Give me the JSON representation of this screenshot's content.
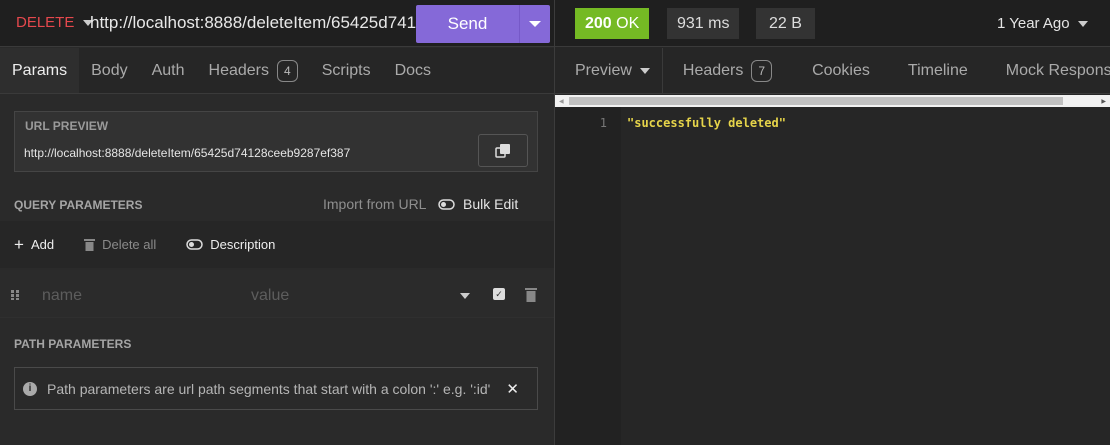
{
  "request": {
    "method": "DELETE",
    "url": "http://localhost:8888/deleteItem/65425d74128",
    "send_label": "Send",
    "tabs": [
      {
        "label": "Params"
      },
      {
        "label": "Body"
      },
      {
        "label": "Auth"
      },
      {
        "label": "Headers",
        "count": "4"
      },
      {
        "label": "Scripts"
      },
      {
        "label": "Docs"
      }
    ],
    "url_preview": {
      "title": "URL PREVIEW",
      "value": "http://localhost:8888/deleteItem/65425d74128ceeb9287ef387"
    },
    "query": {
      "title": "QUERY PARAMETERS",
      "import_label": "Import from URL",
      "bulk_edit_label": "Bulk Edit",
      "add_label": "Add",
      "delete_all_label": "Delete all",
      "description_label": "Description",
      "name_placeholder": "name",
      "value_placeholder": "value"
    },
    "path": {
      "title": "PATH PARAMETERS",
      "info": "Path parameters are url path segments that start with a colon ':' e.g. ':id'"
    }
  },
  "response": {
    "status": "200",
    "status_text": "OK",
    "status_color": "#75ba24",
    "time": "931 ms",
    "size": "22 B",
    "history": "1 Year Ago",
    "tabs": [
      {
        "label": "Preview"
      },
      {
        "label": "Headers",
        "count": "7"
      },
      {
        "label": "Cookies"
      },
      {
        "label": "Timeline"
      },
      {
        "label": "Mock Response"
      }
    ],
    "lines": [
      {
        "num": "1",
        "text": "\"successfully deleted\""
      }
    ]
  }
}
